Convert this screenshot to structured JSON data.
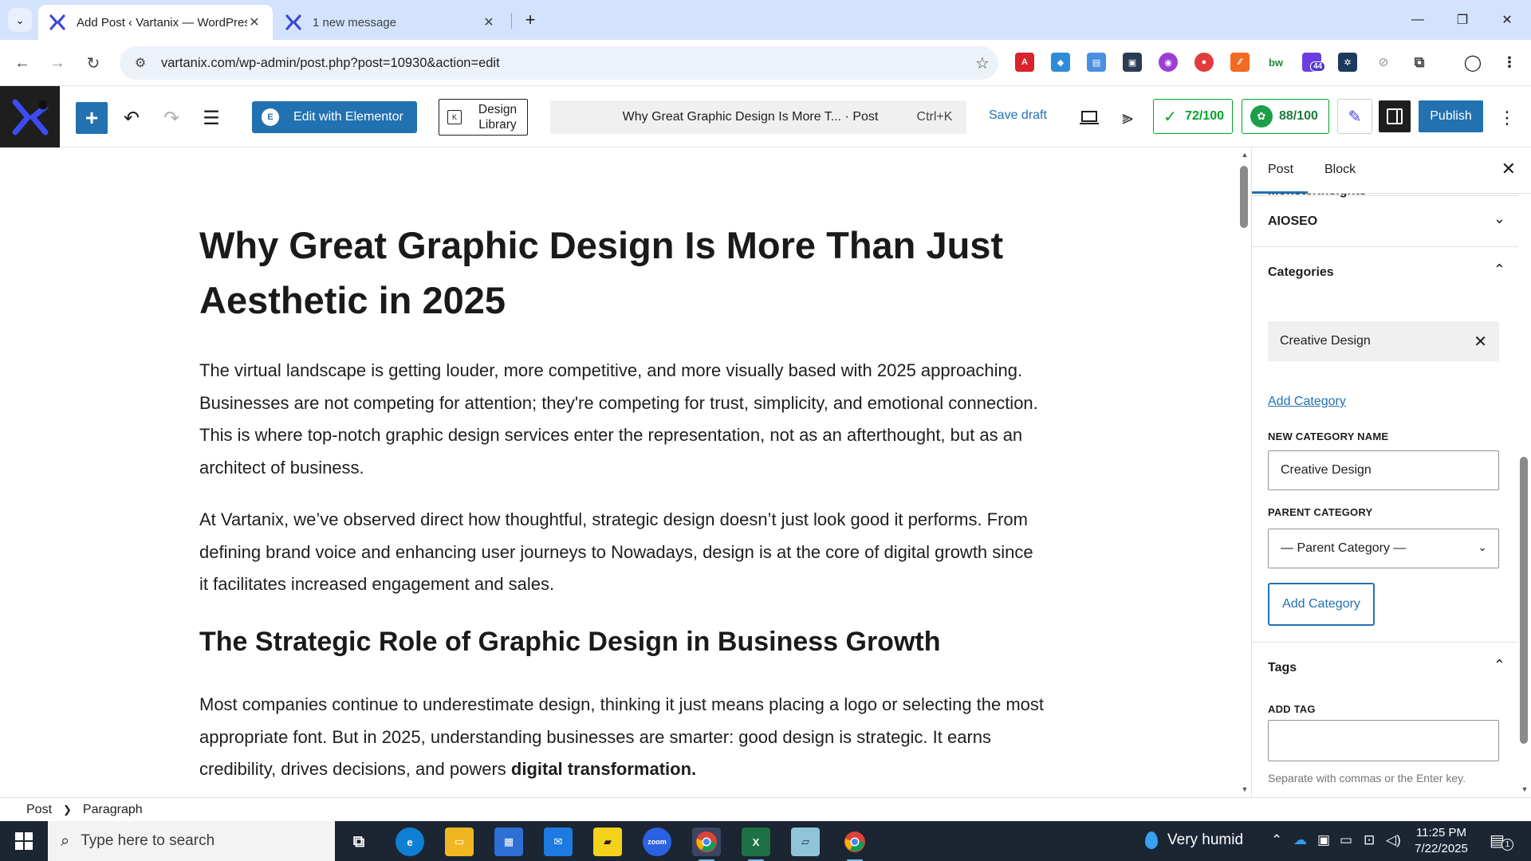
{
  "browser": {
    "tabs": [
      {
        "title": "Add Post ‹ Vartanix — WordPress",
        "active": true
      },
      {
        "title": "1 new message",
        "active": false
      }
    ],
    "url": "vartanix.com/wp-admin/post.php?post=10930&action=edit",
    "extension_badge": "44"
  },
  "toolbar": {
    "elementor_label": "Edit with Elementor",
    "design_library_label": "Design Library",
    "document_title": "Why Great Graphic Design Is More T... · Post",
    "command_shortcut": "Ctrl+K",
    "save_draft_label": "Save draft",
    "seo_score": "72/100",
    "readability_score": "88/100",
    "publish_label": "Publish"
  },
  "post": {
    "title": "Why Great Graphic Design Is More Than Just Aesthetic in 2025",
    "paragraph1": "The virtual landscape is getting louder, more competitive, and more visually based with 2025 approaching. Businesses are not competing for attention; they're competing for trust, simplicity, and emotional connection. This is where top-notch graphic design services enter the representation, not as an afterthought, but as an architect of business.",
    "paragraph2": "At Vartanix, we’ve observed direct how thoughtful, strategic design doesn’t just look good it performs. From defining brand voice and enhancing user journeys to Nowadays, design is at the core of digital growth since it facilitates increased engagement and sales.",
    "heading2": "The Strategic Role of Graphic Design in Business Growth",
    "paragraph3_start": "Most companies continue to underestimate design, thinking it just means placing a logo or selecting the most appropriate font. But in 2025, understanding businesses are smarter: good design is strategic. It earns credibility, drives decisions, and powers ",
    "paragraph3_bold": "digital transformation."
  },
  "sidebar": {
    "tab_post": "Post",
    "tab_block": "Block",
    "cut_off_panel": "MonsterInsights",
    "aioseo_title": "AIOSEO",
    "categories_title": "Categories",
    "selected_category": "Creative Design",
    "add_category_link": "Add Category",
    "new_category_label": "NEW CATEGORY NAME",
    "new_category_value": "Creative Design",
    "parent_category_label": "PARENT CATEGORY",
    "parent_category_value": "— Parent Category —",
    "add_category_button": "Add Category",
    "tags_title": "Tags",
    "add_tag_label": "ADD TAG",
    "add_tag_value": "",
    "tags_help": "Separate with commas or the Enter key."
  },
  "breadcrumb": {
    "root": "Post",
    "current": "Paragraph"
  },
  "taskbar": {
    "search_placeholder": "Type here to search",
    "weather": "Very humid",
    "time": "11:25 PM",
    "date": "7/22/2025",
    "notification_count": "1"
  },
  "colors": {
    "wp_blue": "#2271b1",
    "seo_green": "#00a32a",
    "tabstrip": "#d3e3fd",
    "taskbar": "#1c2532"
  }
}
